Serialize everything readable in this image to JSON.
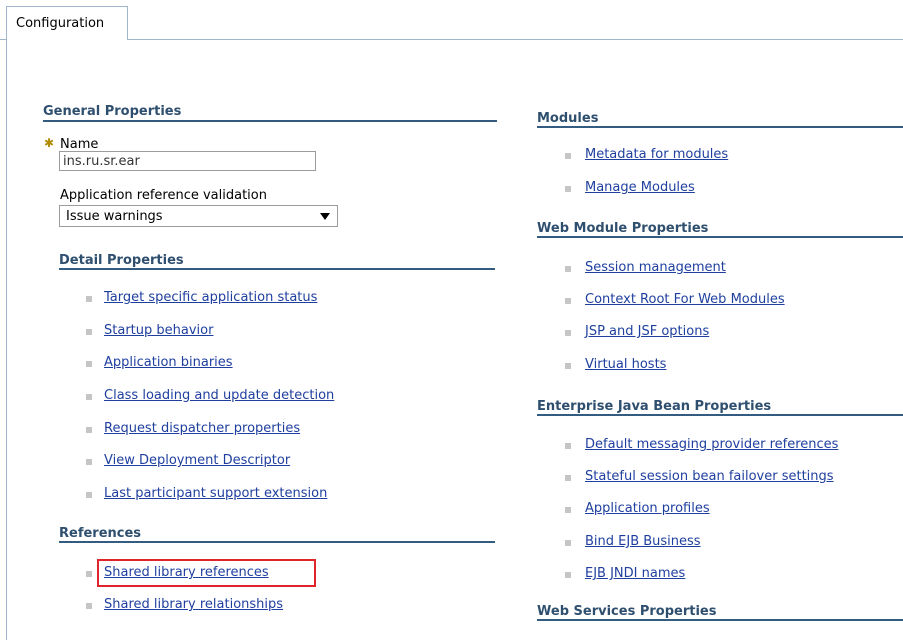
{
  "tabs": [
    {
      "label": "Configuration"
    }
  ],
  "general": {
    "title": "General Properties",
    "name_label": "Name",
    "name_value": "ins.ru.sr.ear",
    "validation_label": "Application reference validation",
    "validation_value": "Issue warnings"
  },
  "detail": {
    "title": "Detail Properties",
    "links": [
      "Target specific application status",
      "Startup behavior",
      "Application binaries",
      "Class loading and update detection",
      "Request dispatcher properties",
      "View Deployment Descriptor",
      "Last participant support extension"
    ]
  },
  "references": {
    "title": "References",
    "links": [
      "Shared library references",
      "Shared library relationships"
    ]
  },
  "modules": {
    "title": "Modules",
    "links": [
      "Metadata for modules",
      "Manage Modules"
    ]
  },
  "web_module": {
    "title": "Web Module Properties",
    "links": [
      "Session management",
      "Context Root For Web Modules",
      "JSP and JSF options",
      "Virtual hosts"
    ]
  },
  "ejb": {
    "title": "Enterprise Java Bean Properties",
    "links": [
      "Default messaging provider references",
      "Stateful session bean failover settings",
      "Application profiles",
      "Bind EJB Business",
      "EJB JNDI names"
    ]
  },
  "web_services": {
    "title": "Web Services Properties"
  },
  "colors": {
    "link": "#1f3f9f",
    "section_title": "#2f4f6f",
    "section_rule": "#345b80",
    "highlight": "#e0242c"
  }
}
